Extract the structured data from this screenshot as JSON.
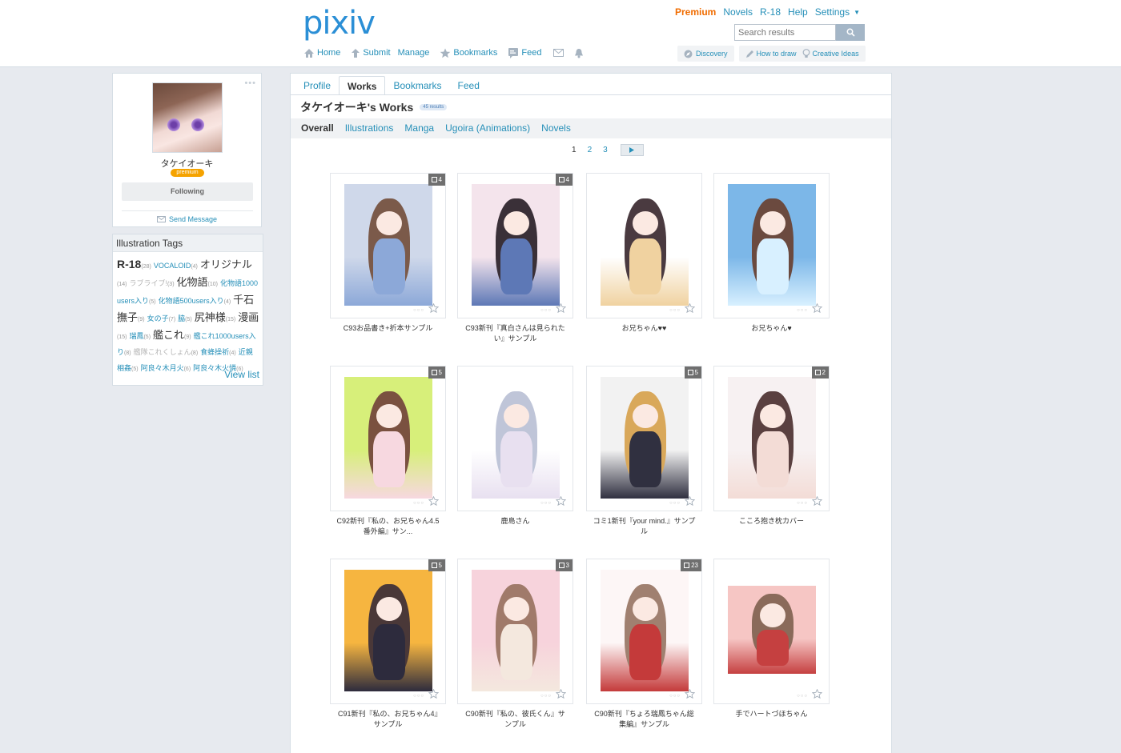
{
  "header": {
    "logo": "pixiv",
    "top_links": [
      "Premium",
      "Novels",
      "R-18",
      "Help",
      "Settings"
    ],
    "search_placeholder": "Search results",
    "nav": [
      "Home",
      "Submit",
      "Manage",
      "Bookmarks",
      "Feed"
    ],
    "nav_right": [
      "Discovery",
      "How to draw",
      "Creative Ideas"
    ]
  },
  "profile": {
    "name": "タケイオーキ",
    "badge": "premium",
    "following_label": "Following",
    "send_message": "Send Message",
    "more": "•••"
  },
  "tags": {
    "title": "Illustration Tags",
    "view_list": "View list",
    "items": [
      {
        "name": "R-18",
        "count": "(28)",
        "style": "big"
      },
      {
        "name": "VOCALOID",
        "count": "(4)",
        "style": "normal"
      },
      {
        "name": "オリジナル",
        "count": "",
        "style": "med"
      },
      {
        "name": "(14)",
        "count": "",
        "style": "cntonly"
      },
      {
        "name": "ラブライブ!",
        "count": "(3)",
        "style": "lite"
      },
      {
        "name": "化物語",
        "count": "(10)",
        "style": "med"
      },
      {
        "name": "化物語1000users入り",
        "count": "(5)",
        "style": "normal"
      },
      {
        "name": "化物語500users入り",
        "count": "(4)",
        "style": "normal"
      },
      {
        "name": "千石撫子",
        "count": "(9)",
        "style": "med"
      },
      {
        "name": "女の子",
        "count": "(7)",
        "style": "normal"
      },
      {
        "name": "脇",
        "count": "(5)",
        "style": "normal"
      },
      {
        "name": "尻神様",
        "count": "(15)",
        "style": "med"
      },
      {
        "name": "漫画",
        "count": "(15)",
        "style": "med"
      },
      {
        "name": "瑞鳳",
        "count": "(5)",
        "style": "normal"
      },
      {
        "name": "艦これ",
        "count": "(9)",
        "style": "med"
      },
      {
        "name": "艦これ1000users入り",
        "count": "(8)",
        "style": "normal"
      },
      {
        "name": "艦隊これくしょん",
        "count": "(8)",
        "style": "lite"
      },
      {
        "name": "食蜂操祈",
        "count": "(4)",
        "style": "normal"
      },
      {
        "name": "近親相姦",
        "count": "(5)",
        "style": "normal"
      },
      {
        "name": "阿良々木月火",
        "count": "(6)",
        "style": "normal"
      },
      {
        "name": "阿良々木火憐",
        "count": "(6)",
        "style": "normal"
      }
    ]
  },
  "main": {
    "tabs": [
      "Profile",
      "Works",
      "Bookmarks",
      "Feed"
    ],
    "title": "タケイオーキ's Works",
    "result_count": "45 results",
    "filters": [
      "Overall",
      "Illustrations",
      "Manga",
      "Ugoira (Animations)",
      "Novels"
    ],
    "pages": [
      "1",
      "2",
      "3"
    ]
  },
  "works": [
    {
      "title": "C93お品書き+折本サンプル",
      "pages": "4",
      "palette": [
        "#cfd8ea",
        "#7b5a4a",
        "#8ca8d8"
      ]
    },
    {
      "title": "C93新刊『真白さんは見られたい』サンプル",
      "pages": "4",
      "palette": [
        "#f4e4ec",
        "#3a3038",
        "#5d78b6"
      ]
    },
    {
      "title": "お兄ちゃん♥♥",
      "pages": "",
      "palette": [
        "#ffffff",
        "#4a3a40",
        "#f0d2a0"
      ]
    },
    {
      "title": "お兄ちゃん♥",
      "pages": "",
      "palette": [
        "#7cb7e8",
        "#6b4a3f",
        "#d8f0ff"
      ]
    },
    {
      "title": "C92新刊『私の、お兄ちゃん4.5 番外編』サン...",
      "pages": "5",
      "palette": [
        "#d7ef7a",
        "#7a5140",
        "#f7d8e0"
      ]
    },
    {
      "title": "鹿島さん",
      "pages": "",
      "palette": [
        "#ffffff",
        "#bfc5d8",
        "#e8e0f0"
      ]
    },
    {
      "title": "コミ1新刊『your mind.』サンプル",
      "pages": "5",
      "palette": [
        "#f2f2f2",
        "#d9a85a",
        "#303040"
      ]
    },
    {
      "title": "こころ抱き枕カバー",
      "pages": "2",
      "palette": [
        "#f7f1f2",
        "#5a4040",
        "#f3dcd6"
      ]
    },
    {
      "title": "C91新刊『私の、お兄ちゃん4』サンプル",
      "pages": "5",
      "palette": [
        "#f6b540",
        "#4a3838",
        "#2d2b3d"
      ]
    },
    {
      "title": "C90新刊『私の、彼氏くん』サンプル",
      "pages": "3",
      "palette": [
        "#f7d3dc",
        "#a07a6a",
        "#f4e8de"
      ]
    },
    {
      "title": "C90新刊『ちょろ瑞鳳ちゃん総集編』サンプル",
      "pages": "23",
      "palette": [
        "#fdf6f6",
        "#a08070",
        "#c43a3a"
      ]
    },
    {
      "title": "手でハートづほちゃん",
      "pages": "",
      "palette": [
        "#f6c6c4",
        "#8a6a5a",
        "#c54040"
      ]
    }
  ]
}
